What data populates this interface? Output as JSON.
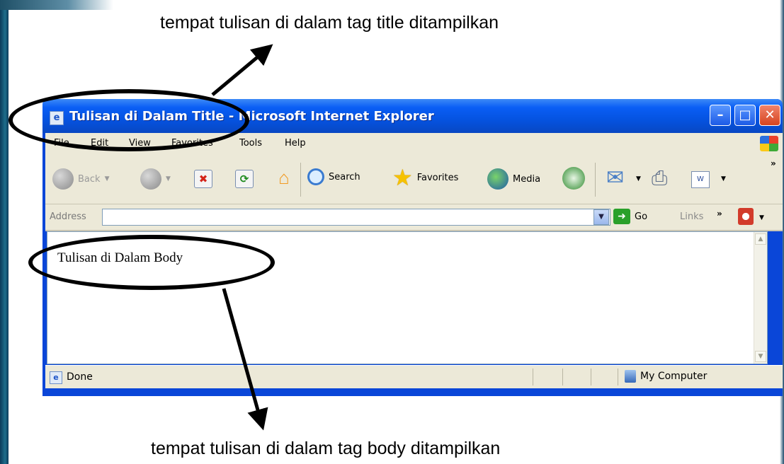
{
  "captions": {
    "top": "tempat tulisan di dalam tag title ditampilkan",
    "bottom": "tempat tulisan di dalam tag body ditampilkan"
  },
  "window": {
    "title": "Tulisan di Dalam Title - Microsoft Internet Explorer",
    "controls": {
      "minimize": "–",
      "maximize": "□",
      "close": "✕"
    }
  },
  "menu": [
    "File",
    "Edit",
    "View",
    "Favorites",
    "Tools",
    "Help"
  ],
  "toolbar": {
    "back": "Back",
    "search": "Search",
    "favorites": "Favorites",
    "media": "Media",
    "more": "»"
  },
  "address": {
    "label": "Address",
    "value": "",
    "go": "Go",
    "links": "Links"
  },
  "content": {
    "body_text": "Tulisan di Dalam Body"
  },
  "status": {
    "text": "Done",
    "zone": "My Computer"
  },
  "icons": {
    "ie": "ie-page-icon",
    "back": "back-arrow-icon",
    "forward": "forward-arrow-icon",
    "stop": "stop-icon",
    "refresh": "refresh-icon",
    "home": "home-icon",
    "search": "search-magnifier-icon",
    "favorites": "favorites-star-icon",
    "media": "media-icon",
    "history": "history-icon",
    "mail": "mail-icon",
    "print": "print-icon",
    "edit": "word-edit-icon",
    "go": "go-arrow-icon",
    "zone": "my-computer-icon"
  }
}
